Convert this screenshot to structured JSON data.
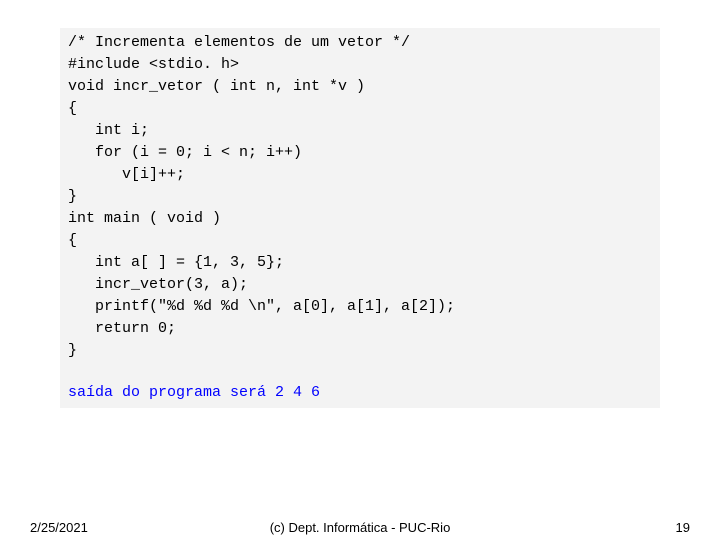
{
  "code": {
    "l1": "/* Incrementa elementos de um vetor */",
    "l2": "#include <stdio. h>",
    "l3": "void incr_vetor ( int n, int *v )",
    "l4": "{",
    "l5": "   int i;",
    "l6": "   for (i = 0; i < n; i++)",
    "l7": "      v[i]++;",
    "l8": "}",
    "l9": "",
    "l10": "int main ( void )",
    "l11": "{",
    "l12": "   int a[ ] = {1, 3, 5};",
    "l13": "   incr_vetor(3, a);",
    "l14": "   printf(\"%d %d %d \\n\", a[0], a[1], a[2]);",
    "l15": "   return 0;",
    "l16": "}"
  },
  "output": "saída do programa será 2 4 6",
  "footer": {
    "date": "2/25/2021",
    "center": "(c) Dept. Informática - PUC-Rio",
    "page": "19"
  }
}
